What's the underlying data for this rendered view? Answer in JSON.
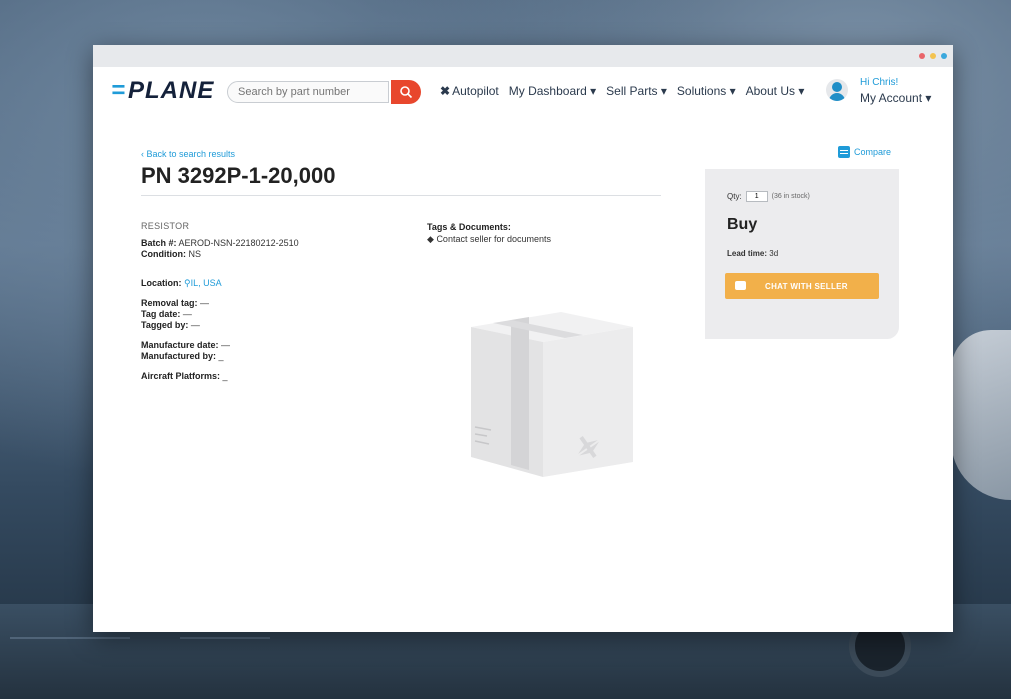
{
  "colors": {
    "brand_blue": "#1f9bd8",
    "search_red": "#e8472d",
    "chat_orange": "#f2b04a",
    "panel_gray": "#ececee"
  },
  "window_controls": [
    {
      "name": "close",
      "color": "#e9656a"
    },
    {
      "name": "minimize",
      "color": "#f3c350"
    },
    {
      "name": "maximize",
      "color": "#3aa8dd"
    }
  ],
  "nav": {
    "logo": "PLANE",
    "search_placeholder": "Search by part number",
    "menu": [
      {
        "label": "Autopilot",
        "prefix": "✖"
      },
      {
        "label": "My Dashboard ▾"
      },
      {
        "label": "Sell Parts ▾"
      },
      {
        "label": "Solutions ▾"
      },
      {
        "label": "About Us ▾"
      }
    ],
    "greeting": "Hi Chris!",
    "account": "My Account ▾"
  },
  "part": {
    "back_link": "‹ Back to search results",
    "title": "PN 3292P-1-20,000",
    "category": "RESISTOR",
    "batch_label": "Batch #:",
    "batch_value": "AEROD-NSN-22180212-2510",
    "condition_label": "Condition:",
    "condition_value": "NS",
    "location_label": "Location:",
    "location_value": "IL, USA",
    "removal_tag_label": "Removal tag:",
    "removal_tag_value": "—",
    "tag_date_label": "Tag date:",
    "tag_date_value": "—",
    "tagged_by_label": "Tagged by:",
    "tagged_by_value": "—",
    "manufacture_date_label": "Manufacture date:",
    "manufacture_date_value": "—",
    "manufactured_by_label": "Manufactured by:",
    "manufactured_by_value": "_",
    "aircraft_platforms_label": "Aircraft Platforms:",
    "aircraft_platforms_value": "_"
  },
  "tags": {
    "header": "Tags & Documents:",
    "item": "Contact seller for documents"
  },
  "compare_label": "Compare",
  "buy": {
    "qty_label": "Qty:",
    "qty_value": "1",
    "stock_text": "(36 in stock)",
    "title": "Buy",
    "lead_label": "Lead time:",
    "lead_value": "3d",
    "chat_button": "CHAT WITH SELLER"
  }
}
